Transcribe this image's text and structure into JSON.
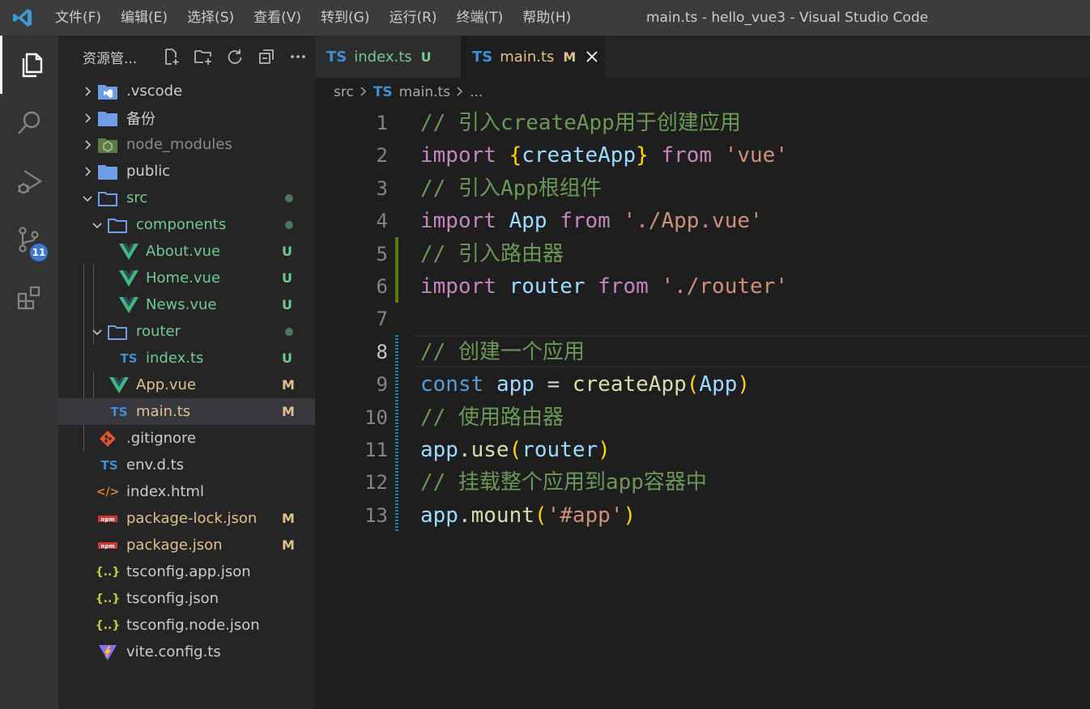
{
  "titlebar": {
    "menu": [
      "文件(F)",
      "编辑(E)",
      "选择(S)",
      "查看(V)",
      "转到(G)",
      "运行(R)",
      "终端(T)",
      "帮助(H)"
    ],
    "window_title": "main.ts - hello_vue3 - Visual Studio Code"
  },
  "activitybar": {
    "source_control_badge": "11"
  },
  "sidebar": {
    "title": "资源管...",
    "items": [
      {
        "label": ".vscode",
        "type": "folder",
        "icon": "vscode-folder-icon",
        "status": ""
      },
      {
        "label": "备份",
        "type": "folder",
        "icon": "folder-icon",
        "status": ""
      },
      {
        "label": "node_modules",
        "type": "folder",
        "icon": "node-folder-icon",
        "status": ""
      },
      {
        "label": "public",
        "type": "folder",
        "icon": "folder-icon",
        "status": ""
      },
      {
        "label": "src",
        "type": "folder",
        "icon": "folder-open-icon",
        "status": ""
      },
      {
        "label": "components",
        "type": "folder",
        "icon": "folder-open-icon",
        "status": ""
      },
      {
        "label": "About.vue",
        "type": "file",
        "icon": "vue-icon",
        "status": "U"
      },
      {
        "label": "Home.vue",
        "type": "file",
        "icon": "vue-icon",
        "status": "U"
      },
      {
        "label": "News.vue",
        "type": "file",
        "icon": "vue-icon",
        "status": "U"
      },
      {
        "label": "router",
        "type": "folder",
        "icon": "folder-open-icon",
        "status": ""
      },
      {
        "label": "index.ts",
        "type": "file",
        "icon": "ts-icon",
        "status": "U"
      },
      {
        "label": "App.vue",
        "type": "file",
        "icon": "vue-icon",
        "status": "M"
      },
      {
        "label": "main.ts",
        "type": "file",
        "icon": "ts-icon",
        "status": "M"
      },
      {
        "label": ".gitignore",
        "type": "file",
        "icon": "git-icon",
        "status": ""
      },
      {
        "label": "env.d.ts",
        "type": "file",
        "icon": "ts-icon",
        "status": ""
      },
      {
        "label": "index.html",
        "type": "file",
        "icon": "html-icon",
        "status": ""
      },
      {
        "label": "package-lock.json",
        "type": "file",
        "icon": "npm-icon",
        "status": "M"
      },
      {
        "label": "package.json",
        "type": "file",
        "icon": "npm-icon",
        "status": "M"
      },
      {
        "label": "tsconfig.app.json",
        "type": "file",
        "icon": "json-icon",
        "status": ""
      },
      {
        "label": "tsconfig.json",
        "type": "file",
        "icon": "json-icon",
        "status": ""
      },
      {
        "label": "tsconfig.node.json",
        "type": "file",
        "icon": "json-icon",
        "status": ""
      },
      {
        "label": "vite.config.ts",
        "type": "file",
        "icon": "vite-icon",
        "status": ""
      }
    ]
  },
  "tabs": [
    {
      "badge": "TS",
      "label": "index.ts",
      "status": "U"
    },
    {
      "badge": "TS",
      "label": "main.ts",
      "status": "M"
    }
  ],
  "breadcrumb": {
    "folder": "src",
    "badge": "TS",
    "file": "main.ts",
    "more": "..."
  },
  "editor": {
    "line_numbers": [
      "1",
      "2",
      "3",
      "4",
      "5",
      "6",
      "7",
      "8",
      "9",
      "10",
      "11",
      "12",
      "13"
    ],
    "lines": [
      "// 引入createApp用于创建应用",
      "import {createApp} from 'vue'",
      "// 引入App根组件",
      "import App from './App.vue'",
      "// 引入路由器",
      "import router from './router'",
      "",
      "// 创建一个应用",
      "const app = createApp(App)",
      "// 使用路由器",
      "app.use(router)",
      "// 挂载整个应用到app容器中",
      "app.mount('#app')"
    ]
  },
  "colors": {
    "modified": "#e2c08d",
    "untracked": "#73c991",
    "comment": "#6a9955",
    "keyword": "#c586c0",
    "variable": "#9cdcfe",
    "function": "#dcdcaa",
    "string": "#ce9178"
  }
}
